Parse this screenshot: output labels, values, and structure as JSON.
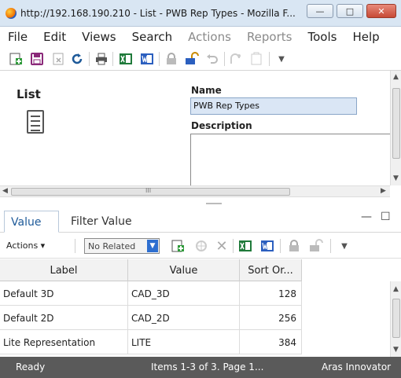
{
  "window": {
    "title": "http://192.168.190.210 - List - PWB Rep Types - Mozilla F...",
    "min_label": "—",
    "max_label": "□",
    "close_label": "✕"
  },
  "menu": [
    "File",
    "Edit",
    "Views",
    "Search",
    "Actions",
    "Reports",
    "Tools",
    "Help"
  ],
  "form": {
    "item_type_title": "List",
    "name_label": "Name",
    "name_value": "PWB Rep Types",
    "description_label": "Description",
    "description_value": ""
  },
  "hscroll": {
    "grip": "III"
  },
  "tabs": {
    "items": [
      "Value",
      "Filter Value"
    ],
    "active": "Value"
  },
  "grid_toolbar": {
    "actions_label": "Actions ▾",
    "related_value": "No Related"
  },
  "grid": {
    "columns": [
      "Label",
      "Value",
      "Sort Or..."
    ],
    "rows": [
      {
        "label": "Default 3D",
        "value": "CAD_3D",
        "sort_order": "128"
      },
      {
        "label": "Default 2D",
        "value": "CAD_2D",
        "sort_order": "256"
      },
      {
        "label": "Lite Representation",
        "value": "LITE",
        "sort_order": "384"
      }
    ]
  },
  "status": {
    "state": "Ready",
    "paging": "Items 1-3 of 3. Page 1...",
    "product": "Aras Innovator"
  },
  "colors": {
    "accent": "#1e5a99",
    "status_bar": "#5a5a5a",
    "name_field": "#dae6f5"
  }
}
